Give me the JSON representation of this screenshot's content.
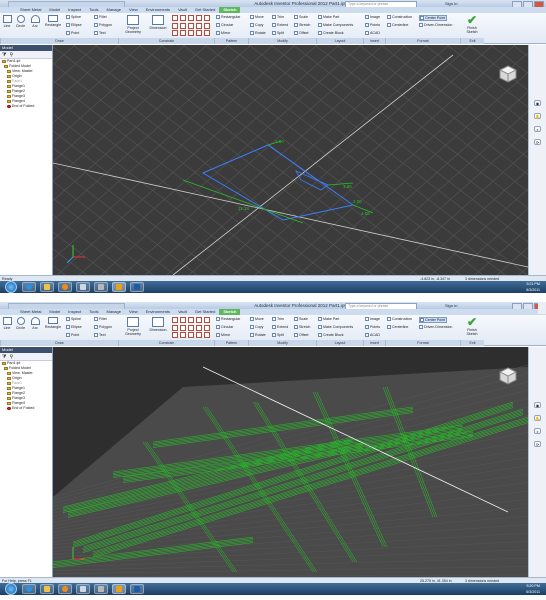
{
  "screenshots": [
    {
      "id": "top",
      "title": "Autodesk Inventor Professional 2012   Part1.ipt",
      "search_placeholder": "Type a keyword or phrase",
      "signin": "Sign In",
      "tabs": [
        "Sheet Metal",
        "Model",
        "Inspect",
        "Tools",
        "Manage",
        "View",
        "Environments",
        "Vault",
        "Get Started",
        "Sketch"
      ],
      "active_tab": "Sketch",
      "draw_tools": {
        "line": "Line",
        "circle": "Circle",
        "arc": "Arc",
        "rectangle": "Rectangle",
        "spline": "Spline",
        "ellipse": "Ellipse",
        "point": "Point",
        "fillet": "Fillet",
        "polygon": "Polygon",
        "text": "Text"
      },
      "project_geometry": "Project Geometry",
      "dimension": "Dimension",
      "pattern_tools": {
        "rectangular": "Rectangular",
        "circular": "Circular",
        "mirror": "Mirror"
      },
      "modify_tools": {
        "move": "Move",
        "copy": "Copy",
        "rotate": "Rotate",
        "trim": "Trim",
        "extend": "Extend",
        "split": "Split",
        "scale": "Scale",
        "stretch": "Stretch",
        "offset": "Offset"
      },
      "layout_tools": {
        "make_part": "Make Part",
        "make_components": "Make Components",
        "create_block": "Create Block"
      },
      "insert_tools": {
        "image": "Image",
        "points": "Points",
        "acad": "ACAD"
      },
      "format_tools": {
        "construction": "Construction",
        "centerline": "Centerline",
        "center_point": "Center Point",
        "driven_dimension": "Driven Dimension"
      },
      "finish_sketch": "Finish Sketch",
      "groups": {
        "draw": "Draw",
        "constrain": "Constrain",
        "pattern": "Pattern",
        "modify": "Modify",
        "layout": "Layout",
        "insert": "Insert",
        "format": "Format",
        "exit": "Exit"
      },
      "browser": {
        "header": "Model",
        "nodes": [
          "Part1.ipt",
          "Folded Model",
          "View: Master",
          "Origin",
          "Face1",
          "Flange1",
          "Flange2",
          "Flange3",
          "Flange4",
          "End of Folded"
        ]
      },
      "sketch_dims": [
        "11.18",
        "4.00",
        "3.86",
        "1.00",
        "2.00"
      ],
      "status": {
        "left": "Ready",
        "coords": "-4.623 in, -8.347 in",
        "dims": "3 dimensions needed"
      },
      "clock": {
        "time": "5:21 PM",
        "date": "6/3/2011"
      }
    },
    {
      "id": "bottom",
      "title": "Autodesk Inventor Professional 2012   Part1.ipt",
      "search_placeholder": "Type a keyword or phrase",
      "signin": "Sign In",
      "tabs": [
        "Sheet Metal",
        "Model",
        "Inspect",
        "Tools",
        "Manage",
        "View",
        "Environments",
        "Vault",
        "Get Started",
        "Sketch"
      ],
      "active_tab": "Sketch",
      "draw_tools": {
        "line": "Line",
        "circle": "Circle",
        "arc": "Arc",
        "rectangle": "Rectangle",
        "spline": "Spline",
        "ellipse": "Ellipse",
        "point": "Point",
        "fillet": "Fillet",
        "polygon": "Polygon",
        "text": "Text"
      },
      "project_geometry": "Project Geometry",
      "dimension": "Dimension",
      "pattern_tools": {
        "rectangular": "Rectangular",
        "circular": "Circular",
        "mirror": "Mirror"
      },
      "modify_tools": {
        "move": "Move",
        "copy": "Copy",
        "rotate": "Rotate",
        "trim": "Trim",
        "extend": "Extend",
        "split": "Split",
        "scale": "Scale",
        "stretch": "Stretch",
        "offset": "Offset"
      },
      "layout_tools": {
        "make_part": "Make Part",
        "make_components": "Make Components",
        "create_block": "Create Block"
      },
      "insert_tools": {
        "image": "Image",
        "points": "Points",
        "acad": "ACAD"
      },
      "format_tools": {
        "construction": "Construction",
        "centerline": "Centerline",
        "center_point": "Center Point",
        "driven_dimension": "Driven Dimension"
      },
      "finish_sketch": "Finish Sketch",
      "groups": {
        "draw": "Draw",
        "constrain": "Constrain",
        "pattern": "Pattern",
        "modify": "Modify",
        "layout": "Layout",
        "insert": "Insert",
        "format": "Format",
        "exit": "Exit"
      },
      "browser": {
        "header": "Model",
        "nodes": [
          "Part1.ipt",
          "Folded Model",
          "View: Master",
          "Origin",
          "Face1",
          "Flange1",
          "Flange2",
          "Flange3",
          "Flange4",
          "End of Folded"
        ]
      },
      "status": {
        "left": "For Help, press F1",
        "coords": "25.275 in, 41.354 in",
        "dims": "3 dimensions needed"
      },
      "clock": {
        "time": "5:20 PM",
        "date": "6/3/2011"
      }
    }
  ],
  "colors": {
    "viewport_bg": "#3b3b3b",
    "grid": "#555555",
    "sketch_green": "#26c226",
    "sketch_blue": "#3d7dff",
    "active_tab": "#5fb760"
  },
  "icons": [
    "line-icon",
    "circle-icon",
    "arc-icon",
    "rectangle-icon",
    "windows-start-icon",
    "ie-icon",
    "folder-icon",
    "inventor-icon",
    "viewcube-icon",
    "finish-check-icon"
  ]
}
